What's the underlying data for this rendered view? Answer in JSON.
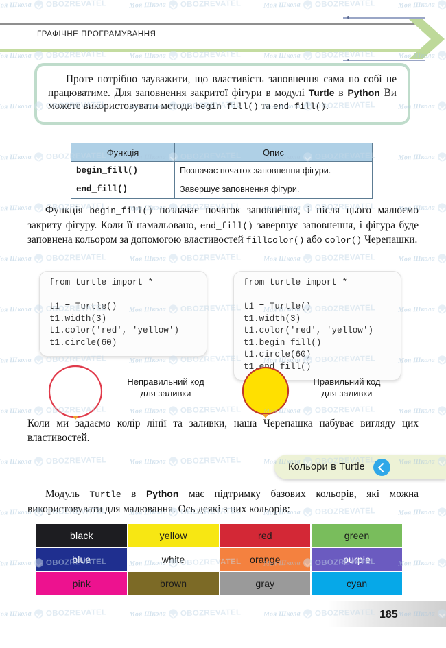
{
  "header": {
    "running_title": "ГРАФІЧНЕ ПРОГРАМУВАННЯ",
    "rule_color": "#8f8f8f",
    "accent_color": "#c4dca0"
  },
  "callout": {
    "text_part1": "Проте потрібно зауважити, що властивість заповнення сама по собі не працюватиме. Для заповнення закритої фігури в модулі ",
    "bold1": "Turtle",
    "text_mid1": " в ",
    "bold2": "Python",
    "text_mid2": " Ви можете використовувати методи ",
    "code1": "begin_fill()",
    "text_mid3": " та ",
    "code2": "end_fill()",
    "text_end": ".",
    "border_color": "#bfdccb"
  },
  "table": {
    "headers": [
      "Функція",
      "Опис"
    ],
    "header_bg": "#afd0e6",
    "border_color": "#5d7c93",
    "rows": [
      {
        "fn": "begin_fill()",
        "desc": "Позначає початок заповнення фігури."
      },
      {
        "fn": "end_fill()",
        "desc": "Завершує заповнення фігури."
      }
    ]
  },
  "paragraph_after_table": {
    "t1": "Функція  ",
    "c1": "begin_fill()",
    "t2": "  позначає початок заповнення, і після цього малюємо закриту фігуру. Коли її намальовано, ",
    "c2": "end_fill()",
    "t3": " завершує заповнення, і фігура буде заповнена кольором за допомогою властивостей ",
    "c3": "fillcolor()",
    "t4": " або ",
    "c4": "color()",
    "t5": " Черепашки."
  },
  "code_blocks": {
    "left": "from turtle import *\n\nt1 = Turtle()\nt1.width(3)\nt1.color('red', 'yellow')\nt1.circle(60)",
    "right": "from turtle import *\n\nt1 = Turtle()\nt1.width(3)\nt1.color('red', 'yellow')\nt1.begin_fill()\nt1.circle(60)\nt1.end_fill()"
  },
  "figures": {
    "left": {
      "caption_line1": "Неправильний код",
      "caption_line2": "для заливки",
      "stroke": "#e03a4a",
      "fill": "none"
    },
    "right": {
      "caption_line1": "Правильний код",
      "caption_line2": "для заливки",
      "stroke": "#c0392b",
      "fill": "#ffe000"
    }
  },
  "paragraph_turtle_look": "Коли ми задаємо колір лінії та заливки, наша Черепашка набуває вигляду цих властивостей.",
  "banner": {
    "label": "Кольори в Turtle",
    "bg": "#edf2d6",
    "icon_bg": "#30a8e8",
    "icon_name": "chevron-left-icon"
  },
  "paragraph_colors": {
    "t1": "Модуль ",
    "c1": "Turtle",
    "t2": " в ",
    "b1": "Python",
    "t3": " має підтримку базових кольорів, які можна використовувати для малювання. Ось деякі з цих кольорів:"
  },
  "colors": [
    {
      "name": "black",
      "bg": "#1d1d21",
      "fg": "#ffffff"
    },
    {
      "name": "yellow",
      "bg": "#f7e713",
      "fg": "#1b1b1b"
    },
    {
      "name": "red",
      "bg": "#d32836",
      "fg": "#1b1b1b"
    },
    {
      "name": "green",
      "bg": "#79bd5c",
      "fg": "#1b1b1b"
    },
    {
      "name": "blue",
      "bg": "#1f2f8f",
      "fg": "#ffffff"
    },
    {
      "name": "white",
      "bg": "#ffffff",
      "fg": "#1b1b1b"
    },
    {
      "name": "orange",
      "bg": "#f4813f",
      "fg": "#1b1b1b"
    },
    {
      "name": "purple",
      "bg": "#6b5bc0",
      "fg": "#ffffff"
    },
    {
      "name": "pink",
      "bg": "#ed128f",
      "fg": "#1b1b1b"
    },
    {
      "name": "brown",
      "bg": "#7c6a26",
      "fg": "#1b1b1b"
    },
    {
      "name": "gray",
      "bg": "#9a9a9a",
      "fg": "#1b1b1b"
    },
    {
      "name": "cyan",
      "bg": "#06a8e8",
      "fg": "#1b1b1b"
    }
  ],
  "footer": {
    "page_number": "185"
  },
  "watermark": {
    "school": "Моя Школа",
    "oboz": "OBOZREVATEL",
    "badge_icon": "circle-check-icon"
  }
}
